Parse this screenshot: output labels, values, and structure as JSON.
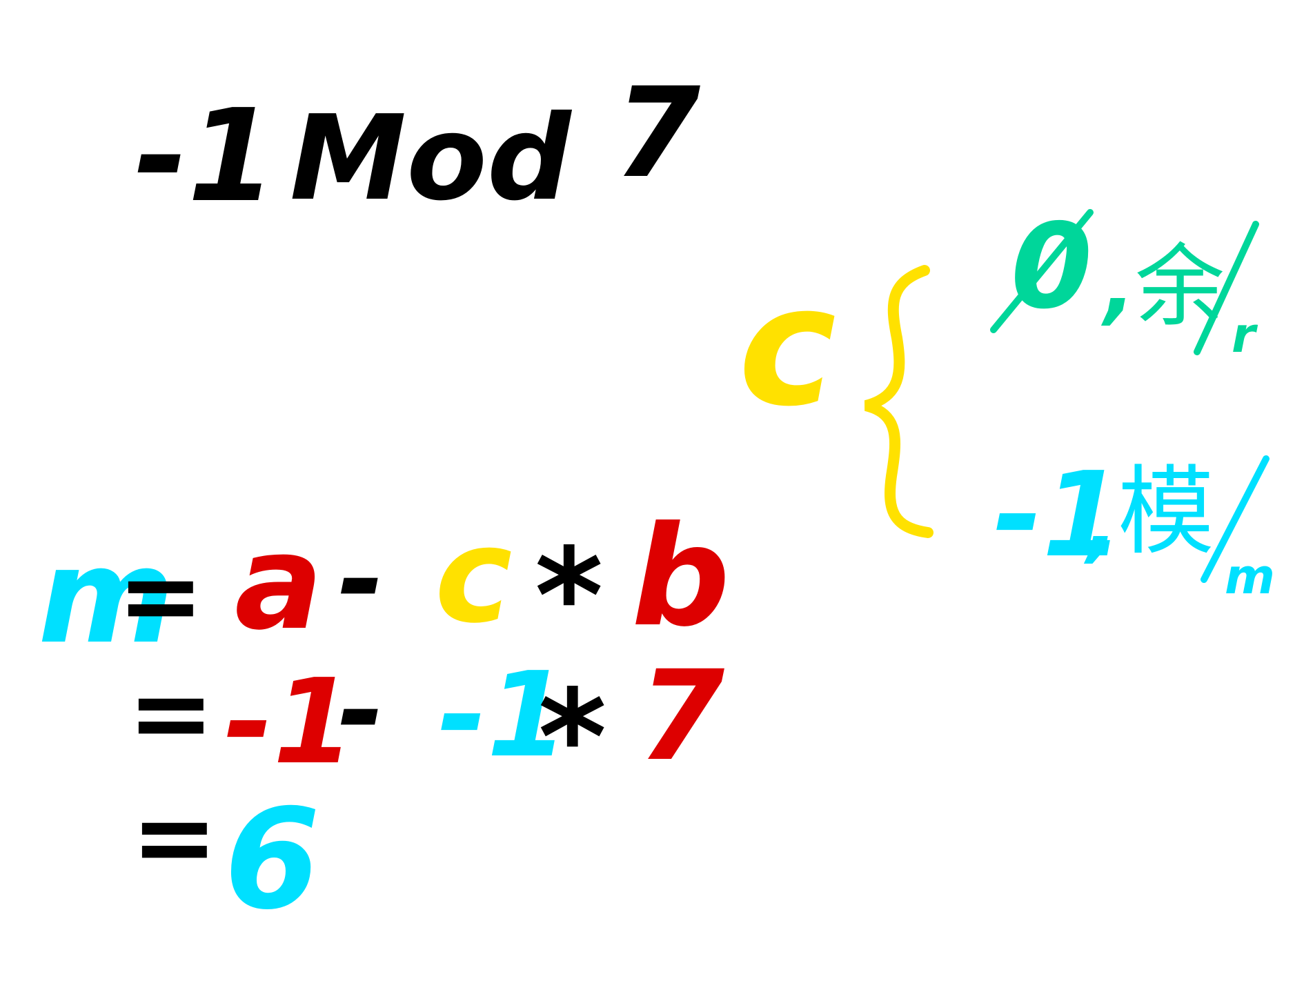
{
  "title": {
    "a": "-1",
    "op": "Mod",
    "b": "7"
  },
  "cases": {
    "brace_var": "c",
    "rem": {
      "value": "0",
      "sep": ",",
      "label": "余",
      "sub": "r"
    },
    "mod": {
      "value": "-1",
      "sep": ",",
      "label": "模",
      "sub": "m"
    }
  },
  "line1": {
    "lhs": "m",
    "eq": "=",
    "a": "a",
    "minus": "-",
    "c": "c",
    "times": "*",
    "b": "b"
  },
  "line2": {
    "eq": "=",
    "a": "-1",
    "minus": "-",
    "c": "-1",
    "times": "*",
    "b": "7"
  },
  "line3": {
    "eq": "=",
    "result": "6"
  },
  "colors": {
    "ink": "#000000",
    "red": "#dd0000",
    "yellow": "#ffe100",
    "cyan": "#00e0ff",
    "green": "#00d69a"
  }
}
